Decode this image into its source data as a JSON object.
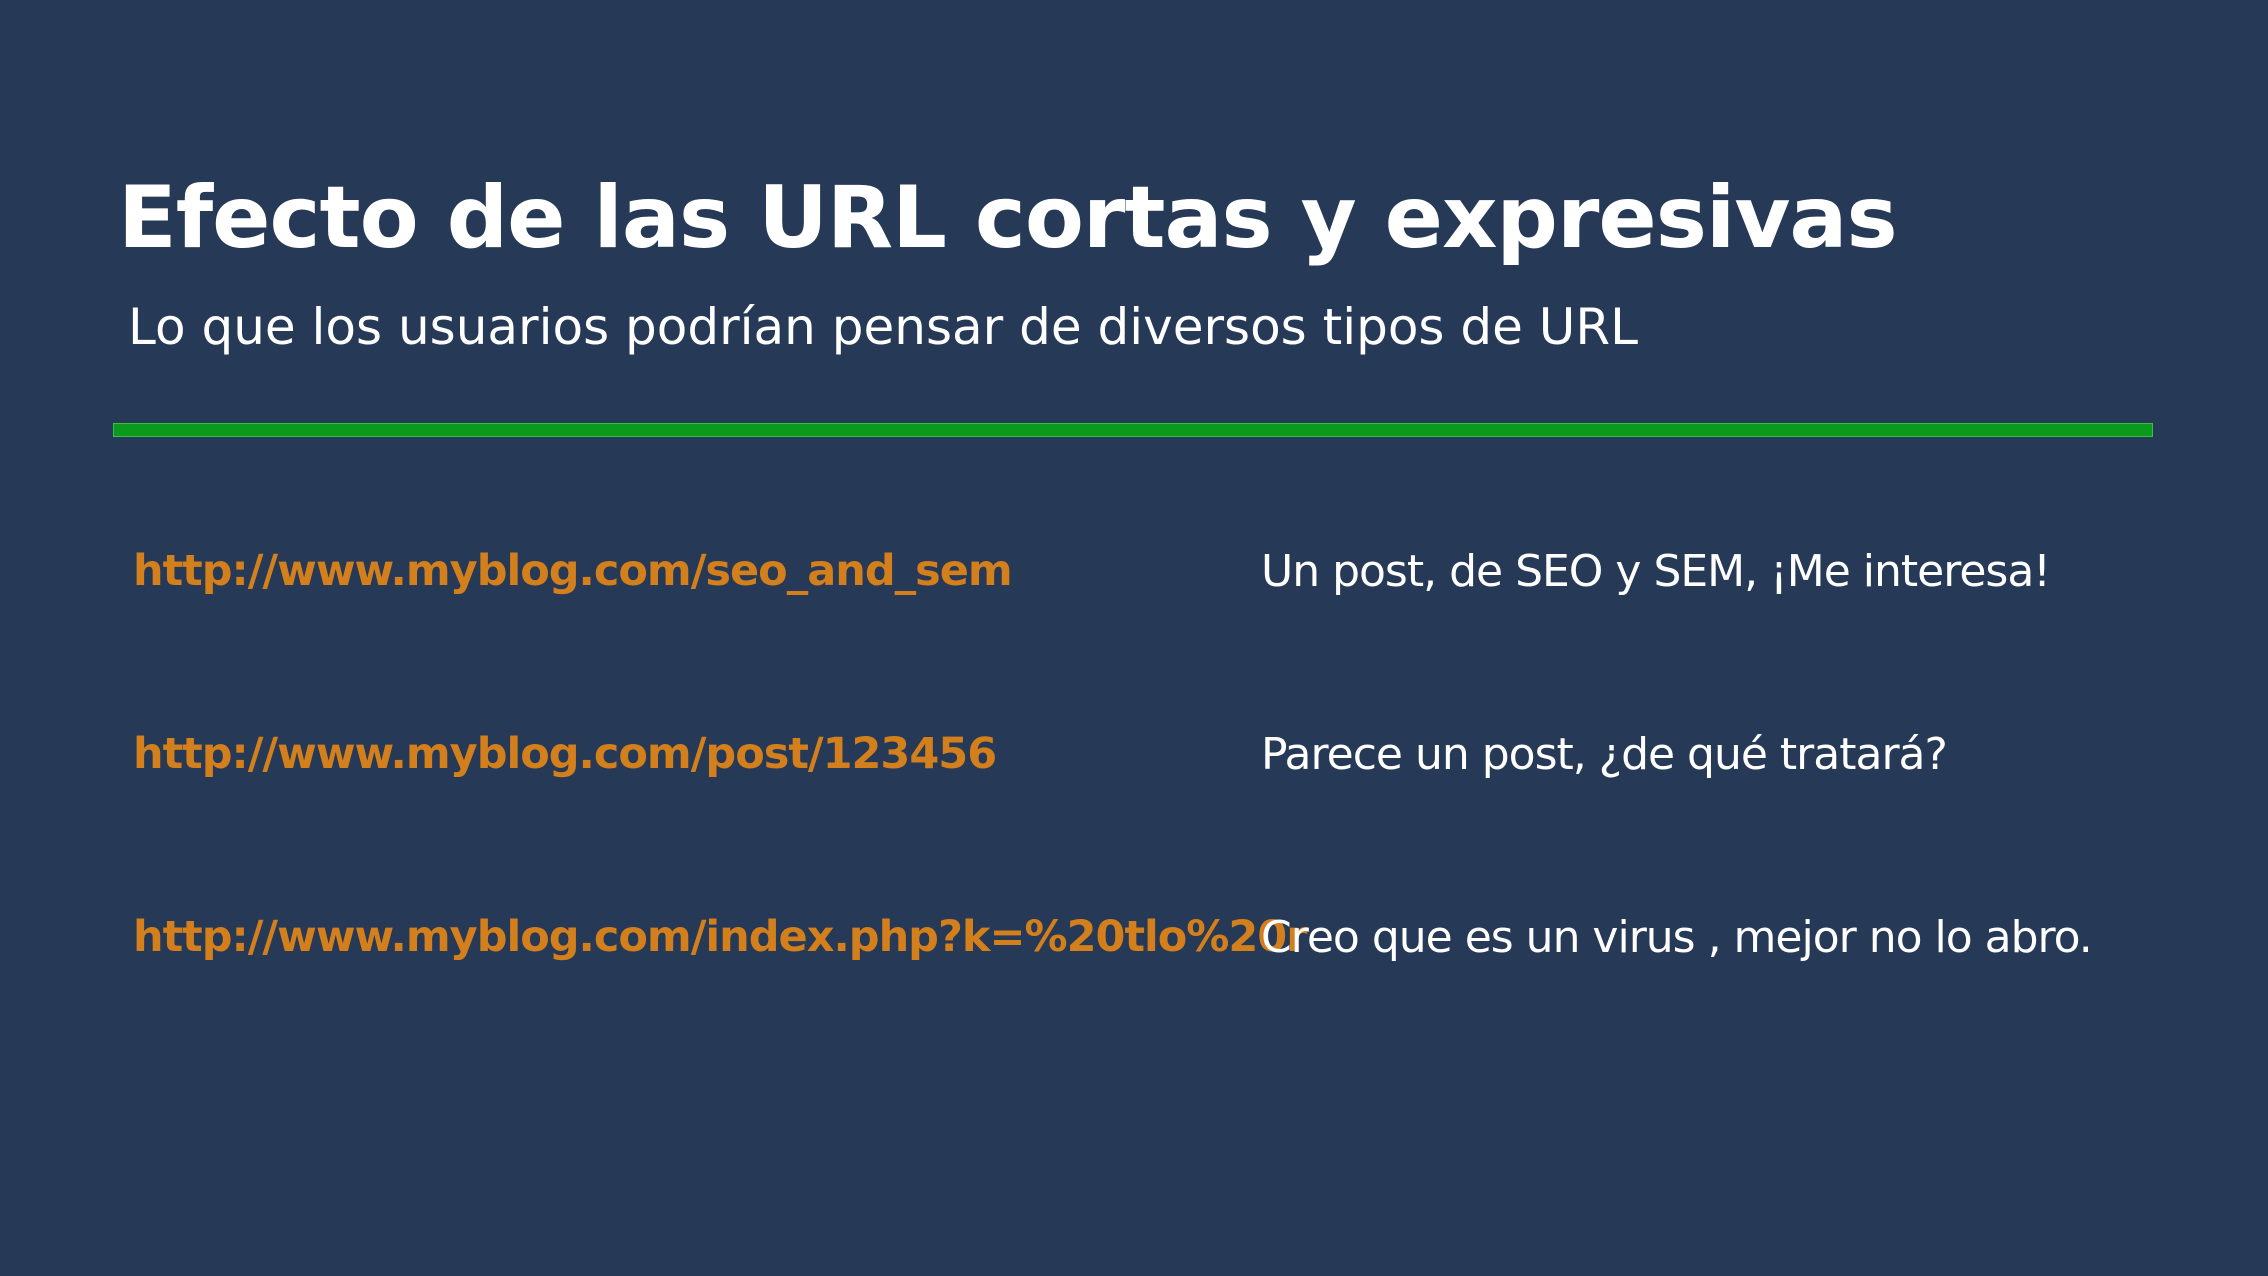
{
  "slide": {
    "title": "Efecto de las URL cortas y expresivas",
    "subtitle": "Lo que los usuarios podrían pensar de diversos tipos de URL",
    "colors": {
      "background": "#263957",
      "divider": "#0b9a1b",
      "url_text": "#d27f1c",
      "text": "#ffffff"
    },
    "rows": [
      {
        "url": "http://www.myblog.com/seo_and_sem",
        "thought": "Un post, de SEO y SEM, ¡Me interesa!"
      },
      {
        "url": "http://www.myblog.com/post/123456",
        "thought": "Parece un post, ¿de qué tratará?"
      },
      {
        "url": "http://www.myblog.com/index.php?k=%20tlo%20r",
        "thought": "Creo que es un virus , mejor no lo abro."
      }
    ]
  }
}
